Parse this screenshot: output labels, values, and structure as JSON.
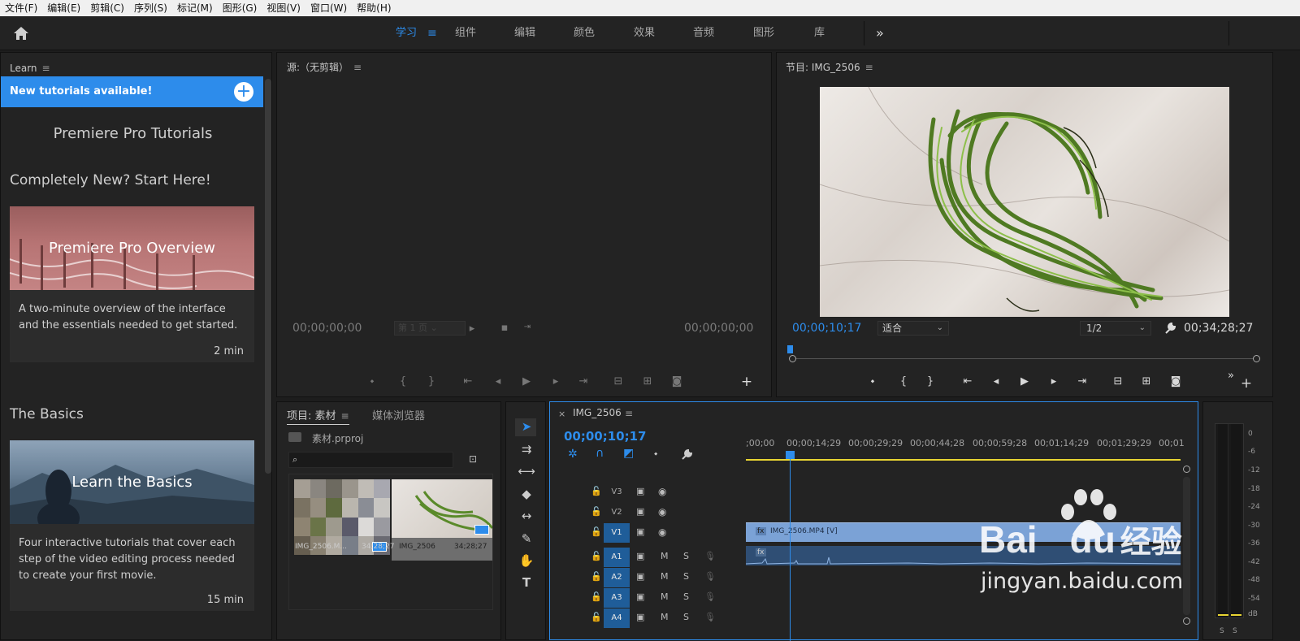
{
  "menu": [
    "文件(F)",
    "编辑(E)",
    "剪辑(C)",
    "序列(S)",
    "标记(M)",
    "图形(G)",
    "视图(V)",
    "窗口(W)",
    "帮助(H)"
  ],
  "workspaces": [
    "学习",
    "组件",
    "编辑",
    "颜色",
    "效果",
    "音频",
    "图形",
    "库"
  ],
  "workspace_active": "学习",
  "more_glyph": "»",
  "learn": {
    "title": "Learn",
    "banner": "New tutorials available!",
    "heading": "Premiere Pro Tutorials",
    "section1": "Completely New? Start Here!",
    "card1": {
      "title": "Premiere Pro Overview",
      "desc": "A two-minute overview of the interface and the essentials needed to get started.",
      "dur": "2 min"
    },
    "section2": "The Basics",
    "card2": {
      "title": "Learn the Basics",
      "desc": "Four interactive tutorials that cover each step of the video editing process needed to create your first movie.",
      "dur": "15 min"
    }
  },
  "source": {
    "title": "源:（无剪辑）",
    "tc_left": "00;00;00;00",
    "tc_right": "00;00;00;00",
    "page_select": "第 1 页"
  },
  "program": {
    "title": "节目: IMG_2506",
    "tc_left": "00;00;10;17",
    "fit": "适合",
    "res": "1/2",
    "tc_right": "00;34;28;27"
  },
  "project": {
    "tab1": "项目: 素材",
    "tab2": "媒体浏览器",
    "file": "素材.prproj",
    "search_placeholder": "",
    "items": [
      {
        "name": "IMG_2506.M...",
        "dur": "34;28;27"
      },
      {
        "name": "IMG_2506",
        "dur": "34;28;27"
      }
    ]
  },
  "timeline": {
    "seq": "IMG_2506",
    "tc": "00;00;10;17",
    "ruler": [
      ";00;00",
      "00;00;14;29",
      "00;00;29;29",
      "00;00;44;28",
      "00;00;59;28",
      "00;01;14;29",
      "00;01;29;29",
      "00;01"
    ],
    "video_tracks": [
      "V3",
      "V2",
      "V1"
    ],
    "audio_tracks": [
      "A1",
      "A2",
      "A3",
      "A4"
    ],
    "clip_video": "IMG_2506.MP4 [V]",
    "fx": "fx",
    "mute": "M",
    "solo": "S"
  },
  "meter": {
    "labels": [
      "0",
      "-6",
      "-12",
      "-18",
      "-24",
      "-30",
      "-36",
      "-42",
      "-48",
      "-54",
      "dB"
    ],
    "bottom": [
      "S",
      "S"
    ]
  },
  "watermark": {
    "brand": "Bai",
    "brand2": "du",
    "cn": "经验",
    "url": "jingyan.baidu.com"
  },
  "colors": {
    "accent": "#2d8ceb",
    "panel": "#232323",
    "yellow": "#e8d432"
  }
}
